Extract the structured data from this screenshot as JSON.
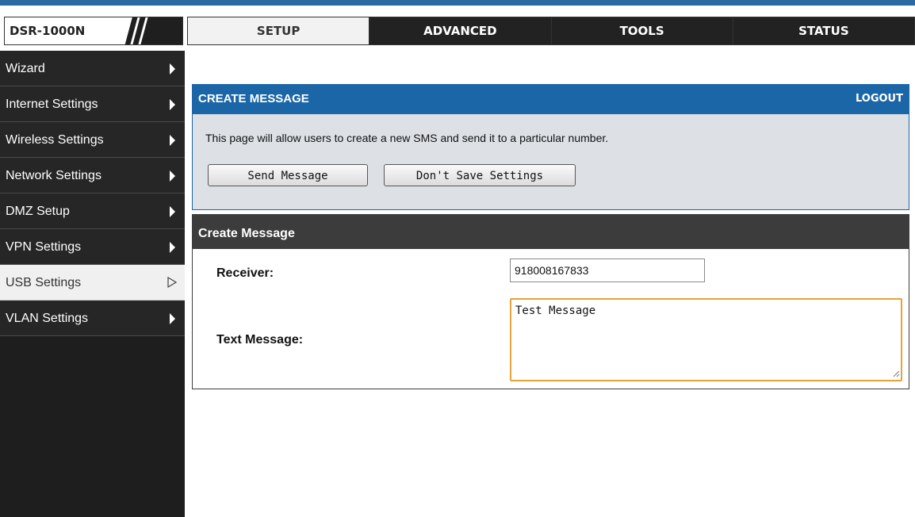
{
  "header": {
    "model": "DSR-1000N",
    "tabs": [
      {
        "label": "SETUP",
        "active": true
      },
      {
        "label": "ADVANCED",
        "active": false
      },
      {
        "label": "TOOLS",
        "active": false
      },
      {
        "label": "STATUS",
        "active": false
      }
    ]
  },
  "sidebar": {
    "items": [
      {
        "label": "Wizard",
        "active": false
      },
      {
        "label": "Internet Settings",
        "active": false
      },
      {
        "label": "Wireless Settings",
        "active": false
      },
      {
        "label": "Network Settings",
        "active": false
      },
      {
        "label": "DMZ Setup",
        "active": false
      },
      {
        "label": "VPN Settings",
        "active": false
      },
      {
        "label": "USB Settings",
        "active": true
      },
      {
        "label": "VLAN Settings",
        "active": false
      }
    ]
  },
  "panel": {
    "title": "CREATE MESSAGE",
    "logout": "LOGOUT",
    "description": "This page will allow users to create a new SMS and send it to a particular number.",
    "send_button": "Send Message",
    "dont_save_button": "Don't Save Settings"
  },
  "form": {
    "section_title": "Create Message",
    "receiver_label": "Receiver:",
    "receiver_value": "918008167833",
    "message_label": "Text Message:",
    "message_value": "Test Message"
  },
  "colors": {
    "accent_blue": "#1b66a6",
    "tab_dark": "#222222",
    "sidebar_bg": "#262626",
    "focus_border": "#e6a23c"
  }
}
